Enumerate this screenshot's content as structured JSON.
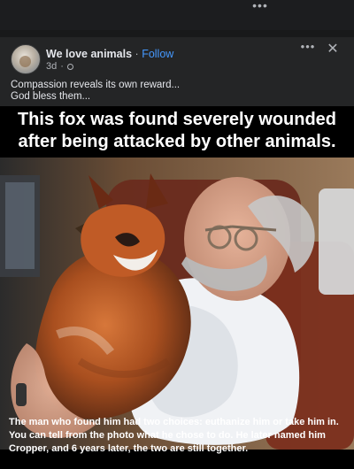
{
  "top_bar": {
    "more_glyph": "•••"
  },
  "post": {
    "author": "We love animals",
    "separator": "·",
    "follow_label": "Follow",
    "time": "3d",
    "privacy_icon": "globe-icon",
    "more_glyph": "•••",
    "close_glyph": "✕",
    "caption_line1": "Compassion reveals its own reward...",
    "caption_line2": "God bless them...",
    "image": {
      "headline_line1": "This fox was found severely wounded",
      "headline_line2": "after being attacked by other animals.",
      "footer": "The man who found him had two choices: euthanize him or take him in. You can tell from the photo what he chose to do. He later named him Cropper, and 6 years later, the two are still together."
    }
  },
  "colors": {
    "background": "#18191a",
    "card": "#242526",
    "link": "#4599ff",
    "secondary_text": "#b0b3b8",
    "primary_text": "#e4e6eb"
  }
}
